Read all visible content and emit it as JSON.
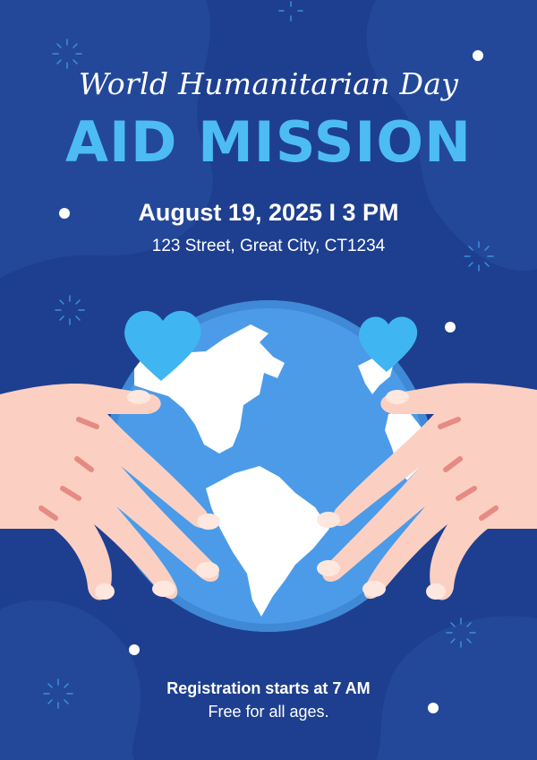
{
  "event": {
    "subtitle": "World Humanitarian Day",
    "title": "AID MISSION",
    "date_time": "August 19, 2025 I 3 PM",
    "address": "123 Street, Great City, CT1234"
  },
  "footer": {
    "registration": "Registration starts at 7 AM",
    "note": "Free for all ages."
  },
  "colors": {
    "background": "#1e3f8f",
    "title_accent": "#4dbcf5",
    "globe": "#4c9be8",
    "heart": "#3fb6f2",
    "hand": "#fbd0c2"
  }
}
